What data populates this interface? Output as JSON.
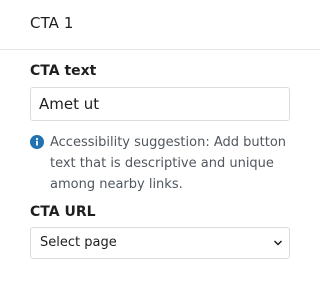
{
  "section": {
    "title": "CTA 1"
  },
  "cta_text": {
    "label": "CTA text",
    "value": "Amet ut"
  },
  "notice": {
    "icon": "info-icon",
    "color": "#2271b1",
    "text": "Accessibility suggestion: Add button text that is descriptive and unique among nearby links."
  },
  "cta_url": {
    "label": "CTA URL",
    "selected": "Select page",
    "icon": "chevron-down-icon"
  }
}
